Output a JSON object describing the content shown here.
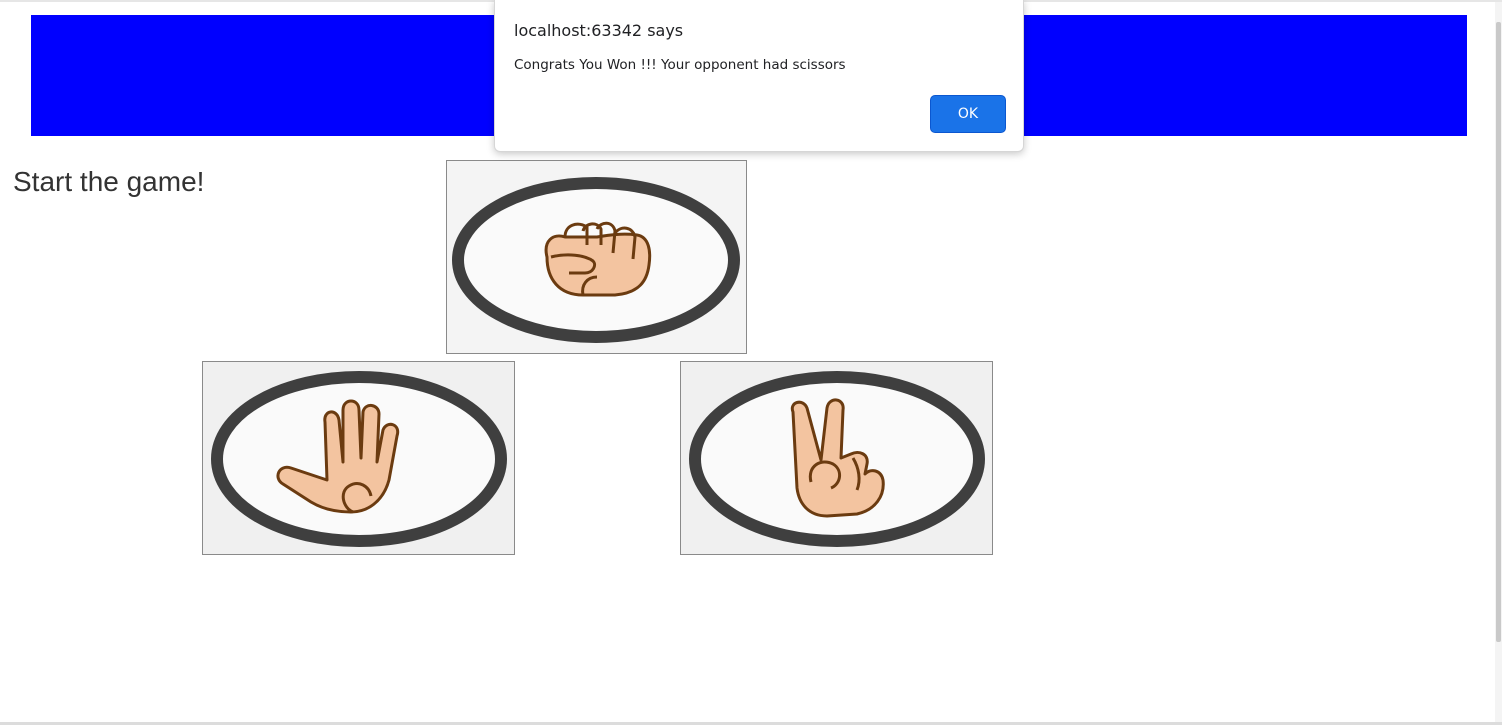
{
  "page": {
    "status_text": "Start the game!",
    "banner_color": "#0000ff"
  },
  "choices": [
    {
      "name": "rock",
      "icon": "fist-hand-icon"
    },
    {
      "name": "paper",
      "icon": "open-hand-icon"
    },
    {
      "name": "scissors",
      "icon": "victory-hand-icon"
    }
  ],
  "alert": {
    "title": "localhost:63342 says",
    "message": "Congrats You Won !!! Your opponent had scissors",
    "ok_label": "OK",
    "button_color": "#1a73e8"
  }
}
